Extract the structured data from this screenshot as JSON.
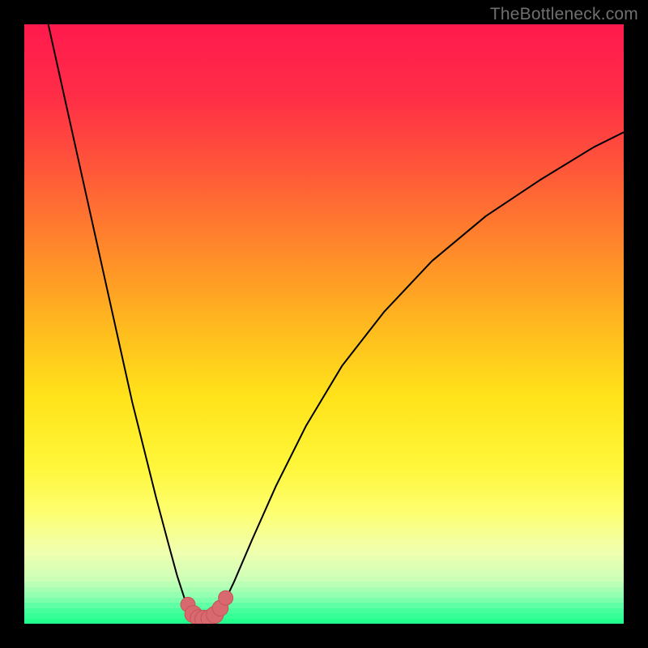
{
  "watermark": "TheBottleneck.com",
  "colors": {
    "background": "#000000",
    "gradient_stops": [
      {
        "offset": 0.0,
        "color": "#ff1a4d"
      },
      {
        "offset": 0.12,
        "color": "#ff2d47"
      },
      {
        "offset": 0.25,
        "color": "#ff5a38"
      },
      {
        "offset": 0.38,
        "color": "#ff8a2a"
      },
      {
        "offset": 0.5,
        "color": "#ffb81f"
      },
      {
        "offset": 0.62,
        "color": "#ffe21a"
      },
      {
        "offset": 0.74,
        "color": "#fff73a"
      },
      {
        "offset": 0.82,
        "color": "#fdff74"
      },
      {
        "offset": 0.88,
        "color": "#f0ffb0"
      },
      {
        "offset": 0.925,
        "color": "#ccffb8"
      },
      {
        "offset": 0.955,
        "color": "#8fffb0"
      },
      {
        "offset": 0.975,
        "color": "#4dffa0"
      },
      {
        "offset": 1.0,
        "color": "#1bff8a"
      }
    ],
    "curve_stroke": "#000000",
    "marker_fill": "#d86a6f",
    "marker_stroke": "#c65358"
  },
  "chart_data": {
    "type": "line",
    "title": "",
    "xlabel": "",
    "ylabel": "",
    "xlim": [
      0,
      100
    ],
    "ylim": [
      0,
      100
    ],
    "series": [
      {
        "name": "left-branch",
        "x": [
          4,
          6,
          8,
          10,
          12,
          14,
          16,
          18,
          20,
          22,
          24,
          25.5,
          26.8,
          27.6
        ],
        "y": [
          100,
          91,
          82,
          73,
          64,
          55,
          46,
          37,
          29,
          21,
          13.5,
          8,
          4,
          2
        ]
      },
      {
        "name": "valley-floor",
        "x": [
          27.6,
          28.4,
          29.2,
          30.0,
          30.8,
          31.6,
          32.4,
          33.1
        ],
        "y": [
          2.0,
          1.2,
          0.8,
          0.7,
          0.8,
          1.1,
          1.8,
          3.0
        ]
      },
      {
        "name": "right-branch",
        "x": [
          33.1,
          35,
          38,
          42,
          47,
          53,
          60,
          68,
          77,
          86,
          95,
          100
        ],
        "y": [
          3.0,
          7,
          14,
          23,
          33,
          43,
          52,
          60.5,
          68,
          74,
          79.5,
          82
        ]
      }
    ],
    "markers": [
      {
        "x": 27.3,
        "y": 3.2,
        "r": 2.2
      },
      {
        "x": 28.2,
        "y": 1.6,
        "r": 2.6
      },
      {
        "x": 29.1,
        "y": 0.9,
        "r": 2.6
      },
      {
        "x": 30.0,
        "y": 0.7,
        "r": 2.8
      },
      {
        "x": 30.9,
        "y": 0.9,
        "r": 2.6
      },
      {
        "x": 31.8,
        "y": 1.5,
        "r": 2.6
      },
      {
        "x": 32.7,
        "y": 2.6,
        "r": 2.4
      },
      {
        "x": 33.6,
        "y": 4.3,
        "r": 2.2
      }
    ]
  }
}
